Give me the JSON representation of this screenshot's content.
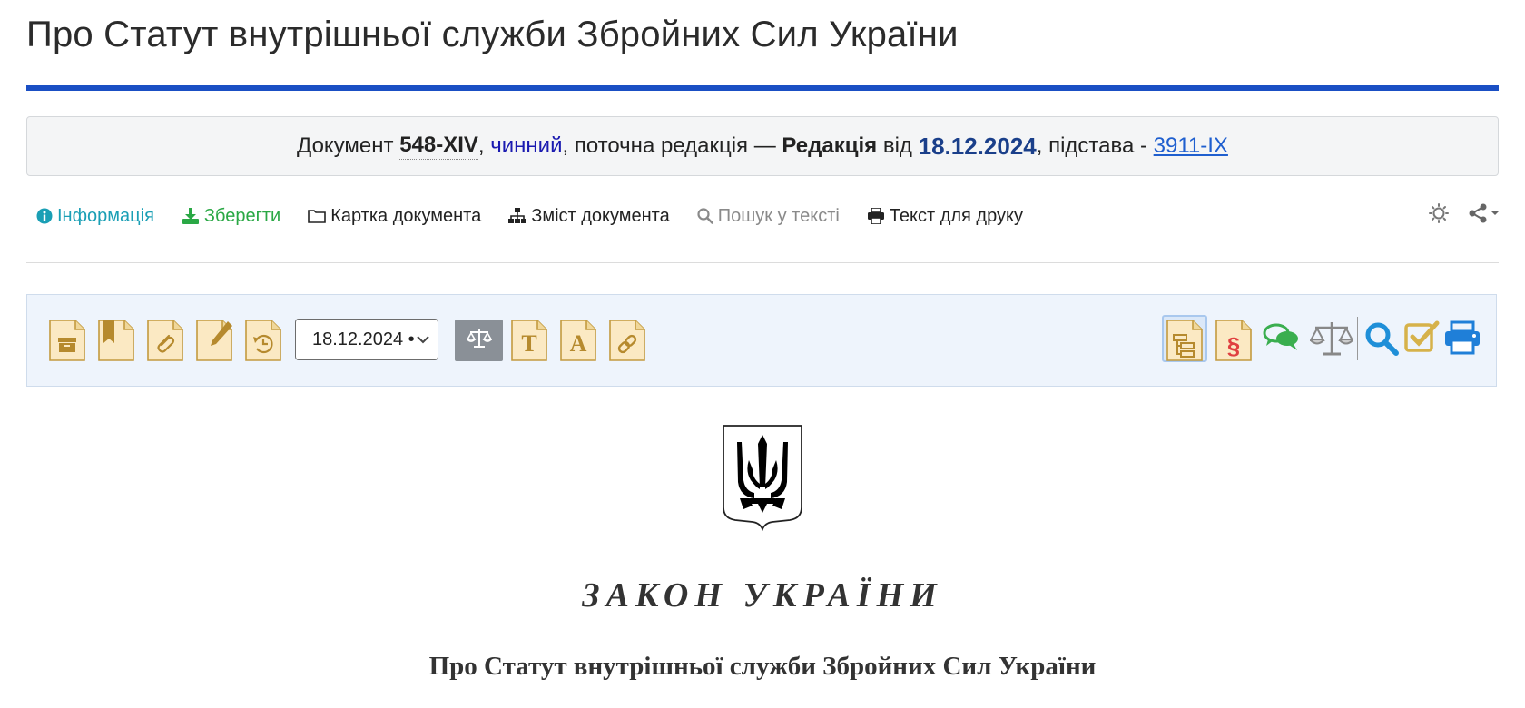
{
  "page": {
    "title": "Про Статут внутрішньої служби Збройних Сил України"
  },
  "banner": {
    "prefix": "Документ",
    "number": "548-XIV",
    "comma1": ",",
    "status": "чинний",
    "middle": ", поточна редакція —",
    "edition_label": "Редакція",
    "from": "від",
    "date": "18.12.2024",
    "basis_label": ", підстава -",
    "basis_link": "3911-IX"
  },
  "nav": {
    "items": [
      {
        "label": "Інформація",
        "icon": "info-circle-icon"
      },
      {
        "label": "Зберегти",
        "icon": "download-icon"
      },
      {
        "label": "Картка документа",
        "icon": "folder-icon"
      },
      {
        "label": "Зміст документа",
        "icon": "sitemap-icon"
      },
      {
        "label": "Пошук у тексті",
        "icon": "search-icon"
      },
      {
        "label": "Текст для друку",
        "icon": "print-icon"
      }
    ],
    "right_icons": [
      "theme-toggle-icon",
      "share-icon"
    ]
  },
  "toolbar": {
    "left_buttons": [
      "archive-doc-icon",
      "bookmark-doc-icon",
      "attachment-doc-icon",
      "edit-doc-icon",
      "history-doc-icon"
    ],
    "date_select_value": "18.12.2024 •",
    "compare_icon": "scales-icon",
    "after_buttons": [
      "text-size-doc-icon",
      "font-doc-icon",
      "link-doc-icon"
    ],
    "right_buttons": [
      "structure-doc-icon",
      "paragraph-doc-icon",
      "comments-icon",
      "scales-icon",
      "search-icon",
      "check-icon",
      "print-icon"
    ]
  },
  "document": {
    "emblem": "coat-of-arms-of-ukraine",
    "heading": "ЗАКОН УКРАЇНИ",
    "title": "Про Статут внутрішньої служби Збройних Сил України"
  },
  "colors": {
    "accent_rule": "#1a4fc4",
    "info": "#1a9fb5",
    "save": "#2aa845",
    "doc_icon_fill": "#fbe9c3",
    "doc_icon_stroke": "#c39a3f",
    "toolbar_bg": "#eef4fc"
  }
}
